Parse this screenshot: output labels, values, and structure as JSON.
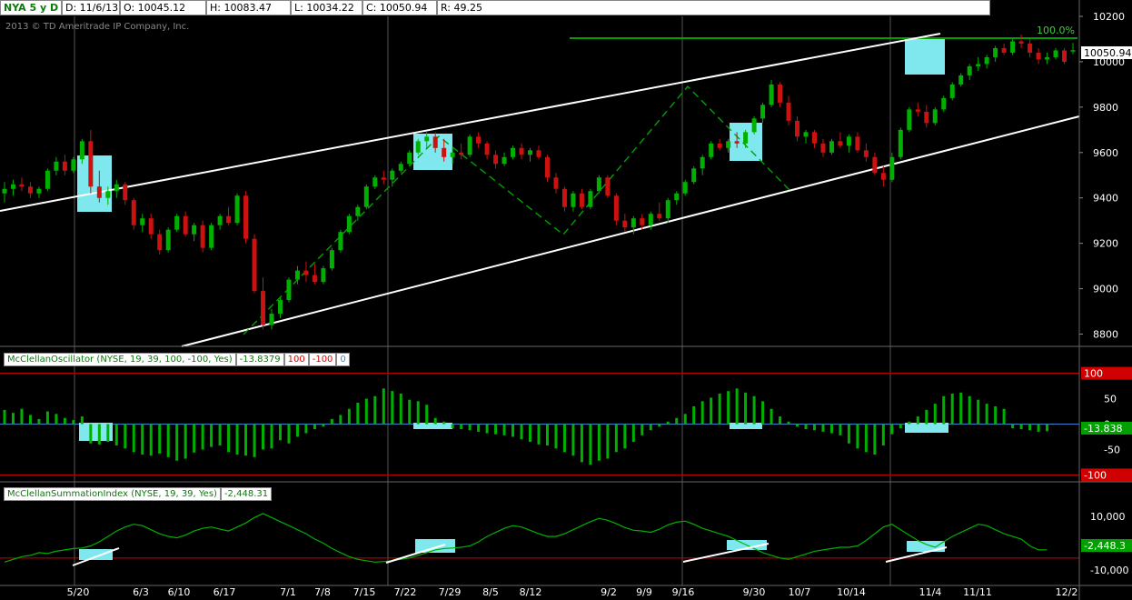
{
  "header": {
    "symbol": "NYA 5 y D",
    "date": "D: 11/6/13",
    "open": "O: 10045.12",
    "high": "H: 10083.47",
    "low": "L: 10034.22",
    "close": "C: 10050.94",
    "range": "R: 49.25"
  },
  "copyright": "2013 © TD Ameritrade IP Company, Inc.",
  "colors": {
    "background": "#000000",
    "up": "#00b000",
    "down": "#cc1111",
    "highlight": "#7fe8ee",
    "channel": "#ffffff",
    "guide": "#00a000",
    "reference_line": "#d00000",
    "zero_line": "#3a7fd0"
  },
  "oscillator_label": {
    "name": "McClellanOscillator (NYSE, 19, 39, 100, -100, Yes)",
    "value": "-13.8379",
    "upper": "100",
    "lower": "-100",
    "zero": "0"
  },
  "summation_label": {
    "name": "McClellanSummationIndex (NYSE, 19, 39, Yes)",
    "value": "-2,448.31"
  },
  "chart_data": [
    {
      "type": "candlestick",
      "title": "NYA 5 y D",
      "ylim": [
        8750,
        10200
      ],
      "y_ticks": [
        "10200",
        "10000",
        "9800",
        "9600",
        "9400",
        "9200",
        "9000",
        "8800"
      ],
      "last_value_label": "10050.94",
      "fib_label": "100.0%",
      "x_date_labels": [
        "5/20",
        "6/3",
        "6/10",
        "6/17",
        "7/1",
        "7/8",
        "7/15",
        "7/22",
        "7/29",
        "8/5",
        "8/12",
        "9/2",
        "9/9",
        "9/16",
        "9/30",
        "10/7",
        "10/14",
        "11/4",
        "11/11",
        "12/2"
      ],
      "bars": [
        [
          9420,
          9470,
          9380,
          9440
        ],
        [
          9440,
          9480,
          9410,
          9460
        ],
        [
          9460,
          9490,
          9430,
          9450
        ],
        [
          9450,
          9470,
          9400,
          9420
        ],
        [
          9420,
          9450,
          9400,
          9440
        ],
        [
          9440,
          9530,
          9430,
          9520
        ],
        [
          9520,
          9580,
          9500,
          9560
        ],
        [
          9560,
          9590,
          9500,
          9520
        ],
        [
          9520,
          9580,
          9510,
          9570
        ],
        [
          9570,
          9660,
          9550,
          9650
        ],
        [
          9650,
          9700,
          9420,
          9450
        ],
        [
          9450,
          9520,
          9380,
          9400
        ],
        [
          9400,
          9450,
          9370,
          9430
        ],
        [
          9430,
          9480,
          9400,
          9460
        ],
        [
          9460,
          9470,
          9370,
          9390
        ],
        [
          9390,
          9400,
          9260,
          9280
        ],
        [
          9280,
          9330,
          9250,
          9310
        ],
        [
          9310,
          9330,
          9220,
          9240
        ],
        [
          9240,
          9260,
          9150,
          9170
        ],
        [
          9170,
          9270,
          9160,
          9260
        ],
        [
          9260,
          9330,
          9250,
          9320
        ],
        [
          9320,
          9340,
          9230,
          9240
        ],
        [
          9240,
          9290,
          9210,
          9280
        ],
        [
          9280,
          9300,
          9160,
          9180
        ],
        [
          9180,
          9290,
          9170,
          9280
        ],
        [
          9280,
          9330,
          9260,
          9320
        ],
        [
          9320,
          9360,
          9280,
          9290
        ],
        [
          9290,
          9420,
          9280,
          9410
        ],
        [
          9410,
          9430,
          9200,
          9220
        ],
        [
          9220,
          9240,
          8980,
          8990
        ],
        [
          8990,
          9050,
          8820,
          8840
        ],
        [
          8840,
          8910,
          8820,
          8890
        ],
        [
          8890,
          8960,
          8870,
          8950
        ],
        [
          8950,
          9050,
          8940,
          9040
        ],
        [
          9040,
          9100,
          9020,
          9080
        ],
        [
          9080,
          9120,
          9030,
          9060
        ],
        [
          9060,
          9110,
          9020,
          9030
        ],
        [
          9030,
          9100,
          9020,
          9090
        ],
        [
          9090,
          9180,
          9080,
          9170
        ],
        [
          9170,
          9260,
          9160,
          9250
        ],
        [
          9250,
          9330,
          9240,
          9320
        ],
        [
          9320,
          9370,
          9300,
          9360
        ],
        [
          9360,
          9460,
          9350,
          9450
        ],
        [
          9450,
          9500,
          9440,
          9490
        ],
        [
          9490,
          9520,
          9460,
          9480
        ],
        [
          9480,
          9530,
          9450,
          9520
        ],
        [
          9520,
          9560,
          9510,
          9550
        ],
        [
          9550,
          9610,
          9540,
          9600
        ],
        [
          9600,
          9660,
          9590,
          9650
        ],
        [
          9650,
          9690,
          9620,
          9670
        ],
        [
          9670,
          9690,
          9600,
          9620
        ],
        [
          9620,
          9660,
          9560,
          9580
        ],
        [
          9580,
          9620,
          9550,
          9600
        ],
        [
          9600,
          9640,
          9570,
          9590
        ],
        [
          9590,
          9680,
          9580,
          9670
        ],
        [
          9670,
          9690,
          9620,
          9640
        ],
        [
          9640,
          9650,
          9570,
          9590
        ],
        [
          9590,
          9610,
          9530,
          9550
        ],
        [
          9550,
          9600,
          9540,
          9580
        ],
        [
          9580,
          9630,
          9570,
          9620
        ],
        [
          9620,
          9640,
          9570,
          9590
        ],
        [
          9590,
          9620,
          9560,
          9610
        ],
        [
          9610,
          9630,
          9570,
          9580
        ],
        [
          9580,
          9590,
          9470,
          9490
        ],
        [
          9490,
          9510,
          9420,
          9440
        ],
        [
          9440,
          9450,
          9340,
          9360
        ],
        [
          9360,
          9430,
          9340,
          9420
        ],
        [
          9420,
          9440,
          9350,
          9360
        ],
        [
          9360,
          9440,
          9350,
          9430
        ],
        [
          9430,
          9500,
          9420,
          9490
        ],
        [
          9490,
          9500,
          9400,
          9410
        ],
        [
          9410,
          9420,
          9280,
          9300
        ],
        [
          9300,
          9330,
          9250,
          9270
        ],
        [
          9270,
          9320,
          9240,
          9310
        ],
        [
          9310,
          9330,
          9260,
          9280
        ],
        [
          9280,
          9340,
          9260,
          9330
        ],
        [
          9330,
          9380,
          9300,
          9310
        ],
        [
          9310,
          9400,
          9290,
          9390
        ],
        [
          9390,
          9430,
          9370,
          9420
        ],
        [
          9420,
          9480,
          9410,
          9470
        ],
        [
          9470,
          9540,
          9460,
          9530
        ],
        [
          9530,
          9590,
          9500,
          9580
        ],
        [
          9580,
          9650,
          9570,
          9640
        ],
        [
          9640,
          9660,
          9610,
          9620
        ],
        [
          9620,
          9660,
          9600,
          9650
        ],
        [
          9650,
          9690,
          9620,
          9640
        ],
        [
          9640,
          9700,
          9620,
          9690
        ],
        [
          9690,
          9760,
          9680,
          9750
        ],
        [
          9750,
          9820,
          9730,
          9810
        ],
        [
          9810,
          9920,
          9800,
          9900
        ],
        [
          9900,
          9910,
          9800,
          9820
        ],
        [
          9820,
          9850,
          9720,
          9740
        ],
        [
          9740,
          9760,
          9650,
          9670
        ],
        [
          9670,
          9700,
          9640,
          9690
        ],
        [
          9690,
          9700,
          9620,
          9640
        ],
        [
          9640,
          9660,
          9580,
          9600
        ],
        [
          9600,
          9660,
          9590,
          9650
        ],
        [
          9650,
          9690,
          9620,
          9630
        ],
        [
          9630,
          9680,
          9600,
          9670
        ],
        [
          9670,
          9690,
          9600,
          9610
        ],
        [
          9610,
          9640,
          9560,
          9580
        ],
        [
          9580,
          9600,
          9500,
          9510
        ],
        [
          9510,
          9540,
          9450,
          9480
        ],
        [
          9480,
          9600,
          9470,
          9580
        ],
        [
          9580,
          9710,
          9570,
          9700
        ],
        [
          9700,
          9800,
          9690,
          9790
        ],
        [
          9790,
          9820,
          9760,
          9780
        ],
        [
          9780,
          9810,
          9710,
          9730
        ],
        [
          9730,
          9800,
          9720,
          9790
        ],
        [
          9790,
          9850,
          9780,
          9840
        ],
        [
          9840,
          9910,
          9830,
          9900
        ],
        [
          9900,
          9950,
          9890,
          9940
        ],
        [
          9940,
          9990,
          9920,
          9980
        ],
        [
          9980,
          10020,
          9960,
          9990
        ],
        [
          9990,
          10030,
          9970,
          10020
        ],
        [
          10020,
          10070,
          10000,
          10060
        ],
        [
          10060,
          10080,
          10030,
          10040
        ],
        [
          10040,
          10100,
          10030,
          10090
        ],
        [
          10090,
          10120,
          10060,
          10080
        ],
        [
          10080,
          10100,
          10020,
          10040
        ],
        [
          10040,
          10060,
          9990,
          10010
        ],
        [
          10010,
          10040,
          9990,
          10020
        ],
        [
          10020,
          10060,
          10010,
          10050
        ],
        [
          10050,
          10060,
          9990,
          10000
        ],
        [
          10045,
          10083,
          10034,
          10051
        ]
      ]
    },
    {
      "type": "bar",
      "title": "McClellanOscillator (NYSE, 19, 39, 100, -100, Yes)",
      "ylim": [
        -110,
        110
      ],
      "y_ticks": [
        "100",
        "50",
        "0",
        "-50"
      ],
      "last_value_label": "-13.838",
      "lower_label": "-100",
      "values": [
        28,
        22,
        30,
        18,
        10,
        25,
        20,
        12,
        8,
        15,
        -38,
        -40,
        -35,
        -42,
        -48,
        -55,
        -60,
        -62,
        -58,
        -65,
        -72,
        -68,
        -56,
        -50,
        -45,
        -42,
        -55,
        -60,
        -62,
        -65,
        -50,
        -48,
        -32,
        -38,
        -25,
        -18,
        -10,
        -5,
        10,
        18,
        30,
        42,
        50,
        55,
        70,
        65,
        60,
        48,
        45,
        38,
        12,
        5,
        -8,
        -10,
        -12,
        -15,
        -18,
        -20,
        -22,
        -25,
        -30,
        -35,
        -40,
        -42,
        -48,
        -55,
        -62,
        -75,
        -80,
        -72,
        -68,
        -55,
        -48,
        -35,
        -22,
        -12,
        -5,
        5,
        12,
        20,
        35,
        45,
        52,
        60,
        65,
        70,
        62,
        55,
        45,
        30,
        15,
        5,
        -5,
        -10,
        -12,
        -15,
        -18,
        -22,
        -38,
        -48,
        -55,
        -60,
        -42,
        -20,
        -8,
        5,
        15,
        28,
        40,
        55,
        60,
        62,
        55,
        48,
        40,
        35,
        30,
        -8,
        -10,
        -12,
        -15,
        -14
      ]
    },
    {
      "type": "line",
      "title": "McClellanSummationIndex (NYSE, 19, 39, Yes)",
      "ylim": [
        -15000,
        15000
      ],
      "y_ticks": [
        "10,000",
        "-10,000"
      ],
      "last_value_label": "-2,448.3",
      "reference_value": -5500,
      "values": [
        -7000,
        -6000,
        -5000,
        -4500,
        -3500,
        -3800,
        -3000,
        -2500,
        -2000,
        -1800,
        -1000,
        500,
        2500,
        4500,
        6000,
        7000,
        6500,
        5000,
        3500,
        2500,
        2000,
        3000,
        4500,
        5500,
        6000,
        5200,
        4500,
        6000,
        7500,
        9500,
        11000,
        9500,
        8000,
        6500,
        5000,
        3500,
        1500,
        0,
        -2000,
        -3500,
        -5000,
        -6000,
        -6500,
        -7000,
        -6800,
        -6500,
        -6000,
        -5500,
        -4500,
        -3500,
        -2500,
        -2000,
        -1800,
        -1500,
        -1000,
        500,
        2500,
        4000,
        5500,
        6500,
        6000,
        4800,
        3500,
        2500,
        2500,
        3500,
        5000,
        6500,
        8000,
        9200,
        8500,
        7200,
        5800,
        4800,
        4500,
        4000,
        5200,
        6800,
        7800,
        8200,
        7000,
        5500,
        4500,
        3500,
        2500,
        1000,
        -500,
        -2000,
        -3500,
        -4500,
        -5500,
        -6000,
        -5000,
        -4000,
        -3000,
        -2500,
        -2000,
        -1500,
        -1500,
        -1000,
        1000,
        3500,
        6000,
        7000,
        5000,
        3000,
        1000,
        -500,
        -1500,
        500,
        2500,
        4000,
        5500,
        7000,
        6500,
        5000,
        3500,
        2500,
        1500,
        -1000,
        -2500,
        -2448
      ]
    }
  ]
}
